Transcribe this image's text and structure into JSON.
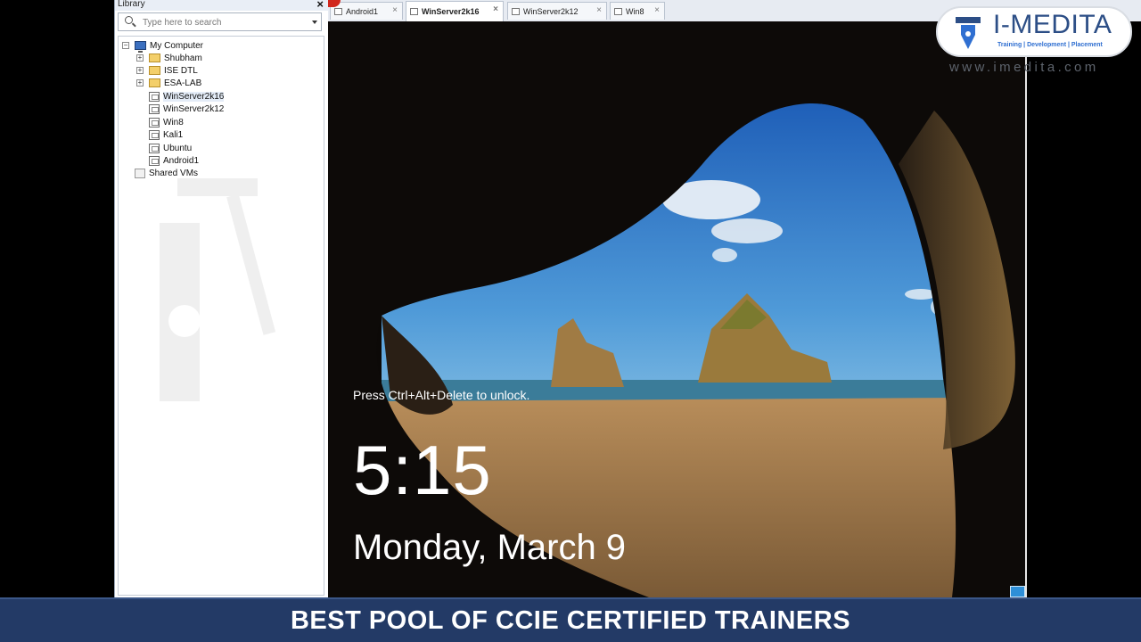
{
  "library": {
    "title": "Library",
    "close_label": "×",
    "search_placeholder": "Type here to search",
    "tree": [
      {
        "label": "My Computer",
        "kind": "computer",
        "expander": "−"
      },
      {
        "label": "Shubham",
        "kind": "folder",
        "expander": "+"
      },
      {
        "label": "ISE DTL",
        "kind": "folder",
        "expander": "+"
      },
      {
        "label": "ESA-LAB",
        "kind": "folder",
        "expander": "+"
      },
      {
        "label": "WinServer2k16",
        "kind": "vm",
        "expander": ""
      },
      {
        "label": "WinServer2k12",
        "kind": "vm",
        "expander": ""
      },
      {
        "label": "Win8",
        "kind": "vm",
        "expander": ""
      },
      {
        "label": "Kali1",
        "kind": "vm",
        "expander": ""
      },
      {
        "label": "Ubuntu",
        "kind": "vm",
        "expander": ""
      },
      {
        "label": "Android1",
        "kind": "vm",
        "expander": ""
      },
      {
        "label": "Shared VMs",
        "kind": "shared",
        "expander": ""
      }
    ]
  },
  "tabs": [
    {
      "label": "Android1",
      "close": "×"
    },
    {
      "label": "WinServer2k16",
      "close": "×"
    },
    {
      "label": "WinServer2k12",
      "close": "×"
    },
    {
      "label": "Win8",
      "close": "×"
    }
  ],
  "lockscreen": {
    "message": "Press Ctrl+Alt+Delete to unlock.",
    "time": "5:15",
    "date": "Monday, March 9"
  },
  "logo": {
    "name": "I-MEDITA",
    "tagline": "Training | Development | Placement",
    "url": "www.imedita.com"
  },
  "banner": {
    "text": "BEST POOL OF CCIE CERTIFIED TRAINERS"
  },
  "colors": {
    "banner": "#233a66",
    "brand": "#2c4e86"
  }
}
